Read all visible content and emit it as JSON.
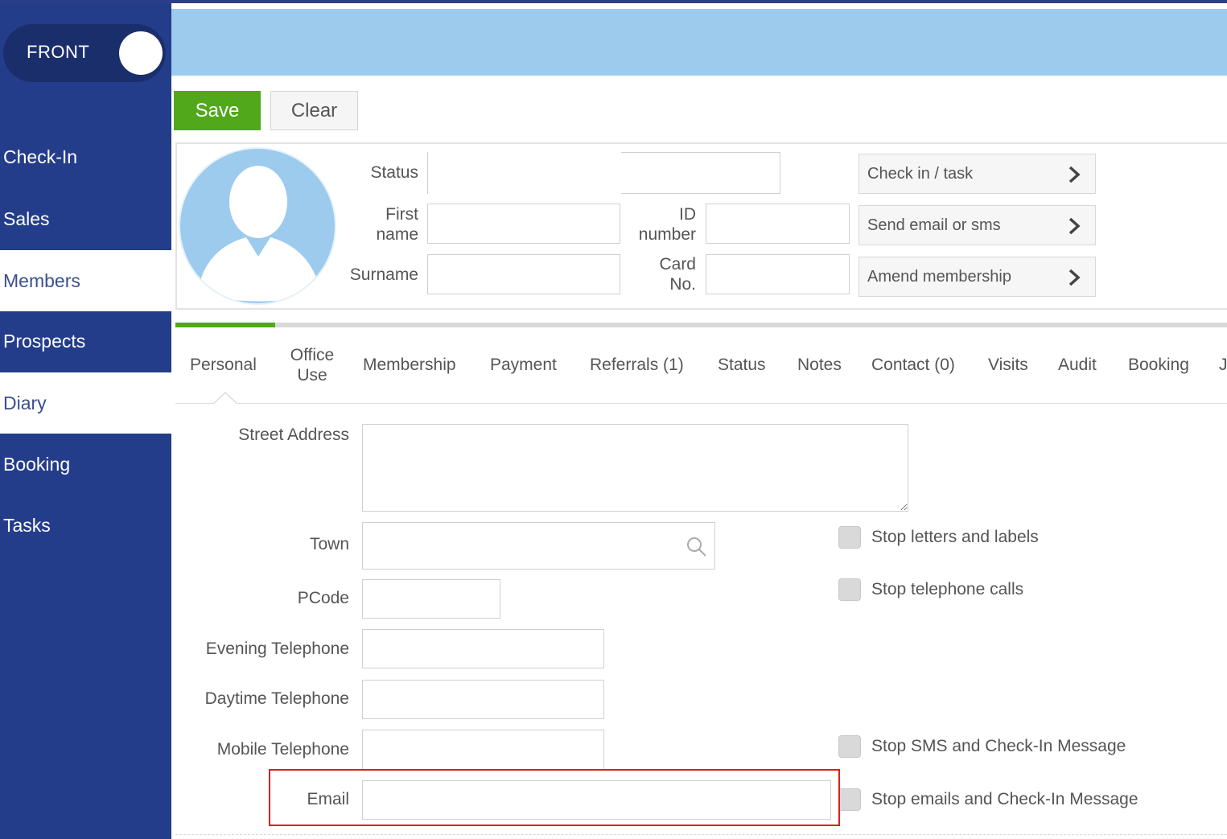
{
  "sidebar": {
    "toggle_label": "FRONT",
    "items": [
      {
        "label": "Check-In",
        "active": false
      },
      {
        "label": "Sales",
        "active": false
      },
      {
        "label": "Members",
        "active": true
      },
      {
        "label": "Prospects",
        "active": false
      },
      {
        "label": "Diary",
        "active": true
      },
      {
        "label": "Booking",
        "active": false
      },
      {
        "label": "Tasks",
        "active": false
      }
    ]
  },
  "toolbar": {
    "save_label": "Save",
    "clear_label": "Clear"
  },
  "member": {
    "status_label": "Status",
    "first_name_label_1": "First",
    "first_name_label_2": "name",
    "surname_label": "Surname",
    "id_label_1": "ID",
    "id_label_2": "number",
    "card_label_1": "Card",
    "card_label_2": "No."
  },
  "actions": {
    "check_in_task": "Check in / task",
    "send_email_sms": "Send email or sms",
    "amend_membership": "Amend membership"
  },
  "progress": {
    "fraction": 0.095
  },
  "tabs": {
    "personal": "Personal",
    "office_use_1": "Office",
    "office_use_2": "Use",
    "membership": "Membership",
    "payment": "Payment",
    "referrals": "Referrals (1)",
    "status": "Status",
    "notes": "Notes",
    "contact": "Contact (0)",
    "visits": "Visits",
    "audit": "Audit",
    "booking": "Booking",
    "overflow": "J"
  },
  "form": {
    "street_address": "Street Address",
    "town": "Town",
    "pcode": "PCode",
    "evening_telephone": "Evening Telephone",
    "daytime_telephone": "Daytime Telephone",
    "mobile_telephone": "Mobile Telephone",
    "email": "Email"
  },
  "preferences": {
    "stop_letters": "Stop letters and labels",
    "stop_calls": "Stop telephone calls",
    "stop_sms": "Stop SMS and Check-In Message",
    "stop_emails": "Stop emails and Check-In Message"
  },
  "colors": {
    "sidebar": "#243d8a",
    "banner": "#9ccbee",
    "save": "#52a81b",
    "highlight": "#d9201f"
  }
}
